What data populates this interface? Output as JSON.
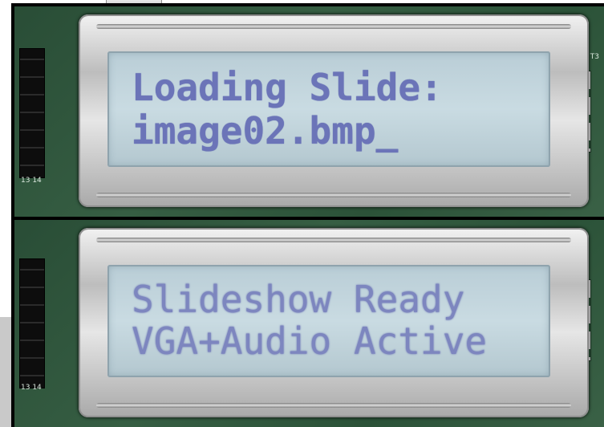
{
  "displays": [
    {
      "line1": "Loading Slide:",
      "line2": "image02.bmp_"
    },
    {
      "line1": "Slideshow Ready",
      "line2": "VGA+Audio Active"
    }
  ],
  "silkscreen": {
    "top_right": "T3",
    "bottom_left_top": "13  14",
    "bottom_left_bottom": "13  14"
  },
  "colors": {
    "lcd_background": "#c9dbe2",
    "lcd_text": "#6b74b8",
    "pcb": "#2f563c",
    "bezel": "#d0d0d0"
  }
}
